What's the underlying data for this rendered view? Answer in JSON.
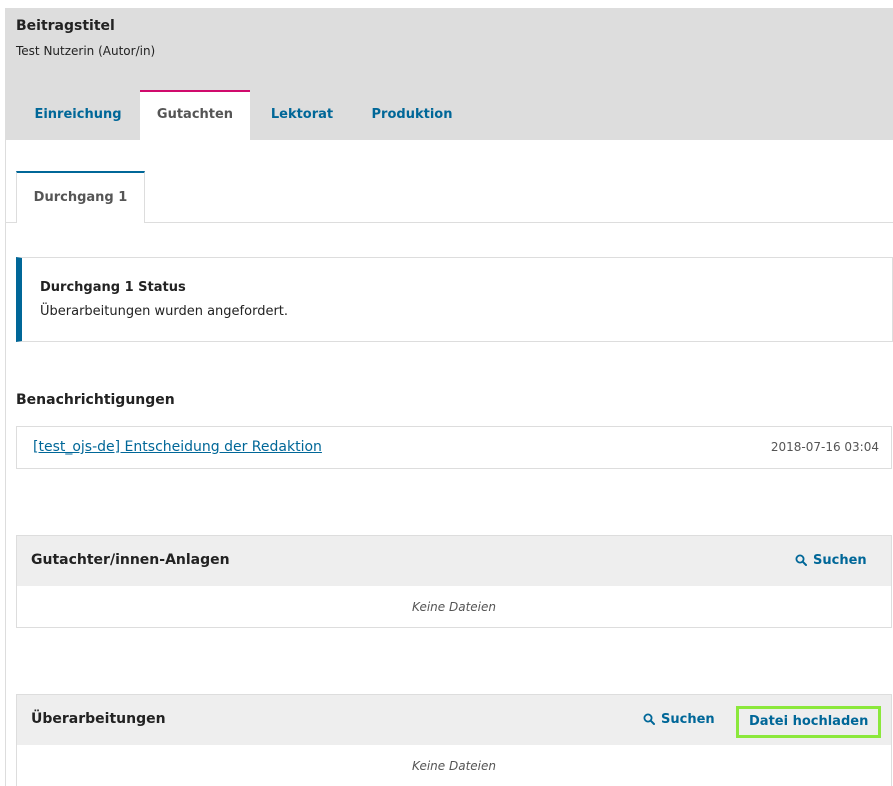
{
  "header": {
    "title": "Beitragstitel",
    "subtitle": "Test Nutzerin (Autor/in)",
    "tabs": [
      {
        "label": "Einreichung",
        "active": false
      },
      {
        "label": "Gutachten",
        "active": true
      },
      {
        "label": "Lektorat",
        "active": false
      },
      {
        "label": "Produktion",
        "active": false
      }
    ]
  },
  "round_tab": {
    "label": "Durchgang 1"
  },
  "status": {
    "title": "Durchgang 1 Status",
    "text": "Überarbeitungen wurden angefordert."
  },
  "notifications": {
    "heading": "Benachrichtigungen",
    "items": [
      {
        "label": "[test_ojs-de] Entscheidung der Redaktion",
        "date": "2018-07-16 03:04"
      }
    ]
  },
  "reviewer_files": {
    "title": "Gutachter/innen-Anlagen",
    "search_label": "Suchen",
    "empty_text": "Keine Dateien"
  },
  "revisions": {
    "title": "Überarbeitungen",
    "search_label": "Suchen",
    "upload_label": "Datei hochladen",
    "empty_text": "Keine Dateien"
  },
  "colors": {
    "link": "#006798",
    "active_tab_accent": "#d00a6c",
    "highlight": "#8be83b",
    "header_bg": "#dddddd",
    "panel_header_bg": "#eeeeee"
  },
  "icons": {
    "search": "search-icon"
  }
}
